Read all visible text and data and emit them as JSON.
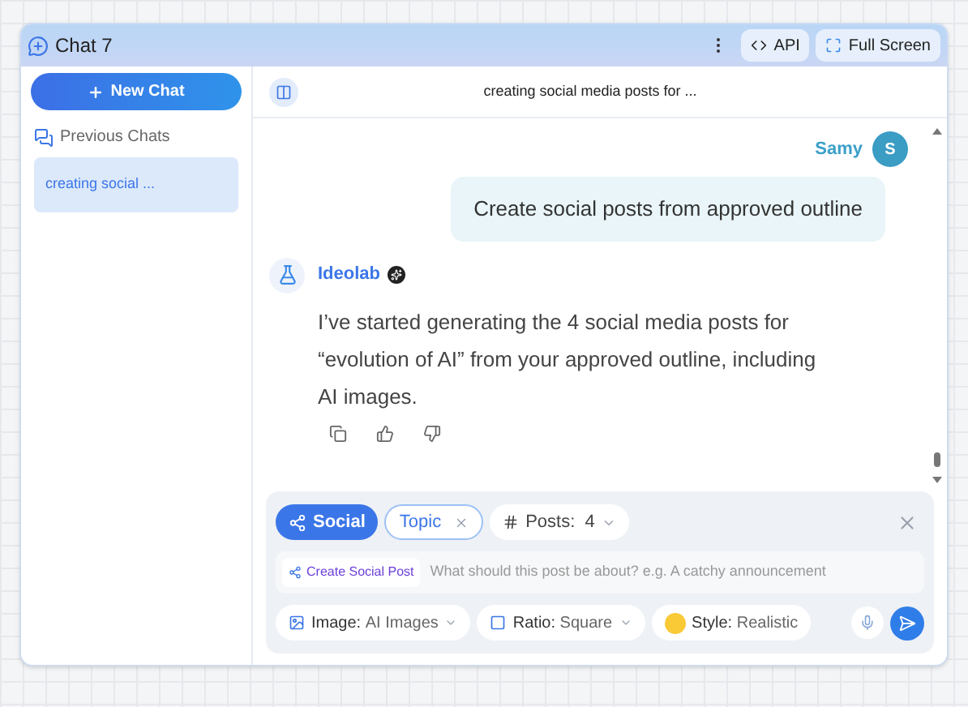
{
  "window": {
    "title": "Chat 7",
    "buttons": [
      {
        "kind": "api",
        "label": "API"
      },
      {
        "kind": "fullscreen",
        "label": "Full Screen"
      }
    ]
  },
  "sidebar": {
    "new_chat": "New Chat",
    "section": "Previous Chats",
    "items": [
      {
        "label": "creating social ...",
        "selected": true
      }
    ]
  },
  "chat": {
    "title": "creating social media posts for ...",
    "messages": [
      {
        "kind": "user",
        "author": "Samy",
        "avatar": "S",
        "text": "Create social posts from approved outline"
      },
      {
        "kind": "bot",
        "author": "Ideolab",
        "text": "I’ve started generating the 4 social media posts for “evolution of AI” from your approved outline, including AI images."
      }
    ]
  },
  "composer": {
    "chips": [
      {
        "kind": "mode",
        "label": "Social"
      },
      {
        "kind": "removable",
        "label": "Topic"
      },
      {
        "kind": "dropdown",
        "label": "Posts:",
        "value": "4"
      }
    ],
    "tag": "Create Social Post",
    "placeholder": "What should this post be about? e.g. A catchy announcement",
    "options": [
      {
        "kind": "image",
        "label": "Image:",
        "value": "AI Images",
        "dropdown": true
      },
      {
        "kind": "ratio",
        "label": "Ratio:",
        "value": "Square",
        "dropdown": true
      },
      {
        "kind": "style",
        "label": "Style:",
        "value": "Realistic",
        "dropdown": false
      }
    ]
  }
}
